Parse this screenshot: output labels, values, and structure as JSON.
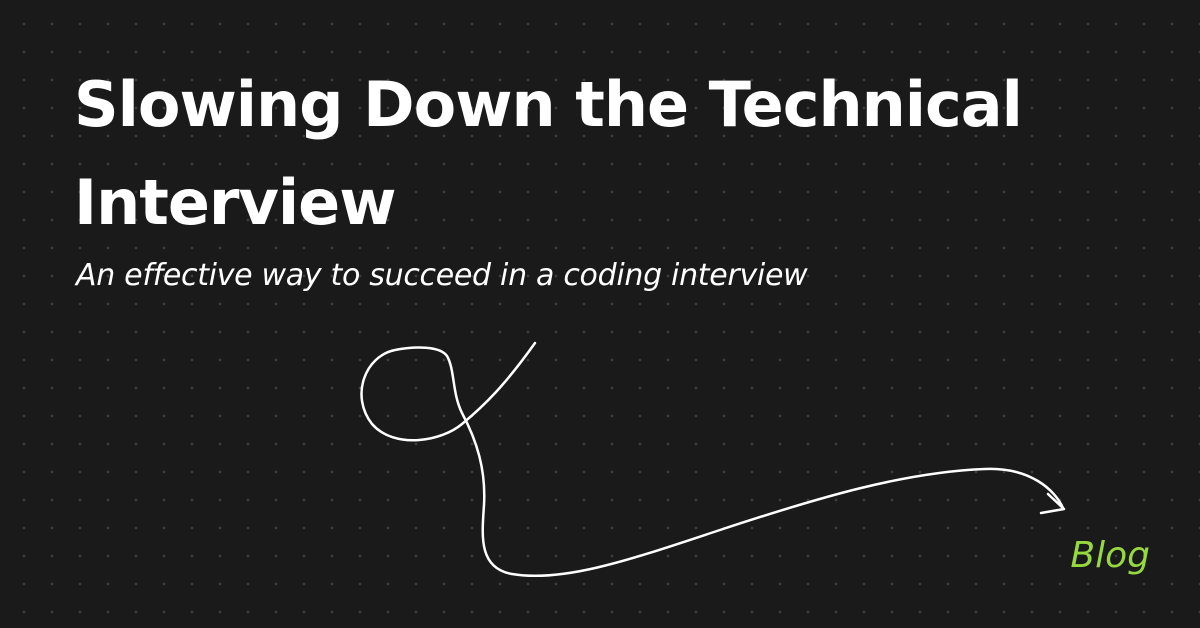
{
  "title": "Slowing Down the Technical Interview",
  "subtitle": "An effective way to succeed in a coding interview",
  "tag": "Blog",
  "colors": {
    "background": "#1a1a1a",
    "text": "#ffffff",
    "accent": "#96d93f"
  },
  "decoration": "hand-drawn-loop-arrow"
}
